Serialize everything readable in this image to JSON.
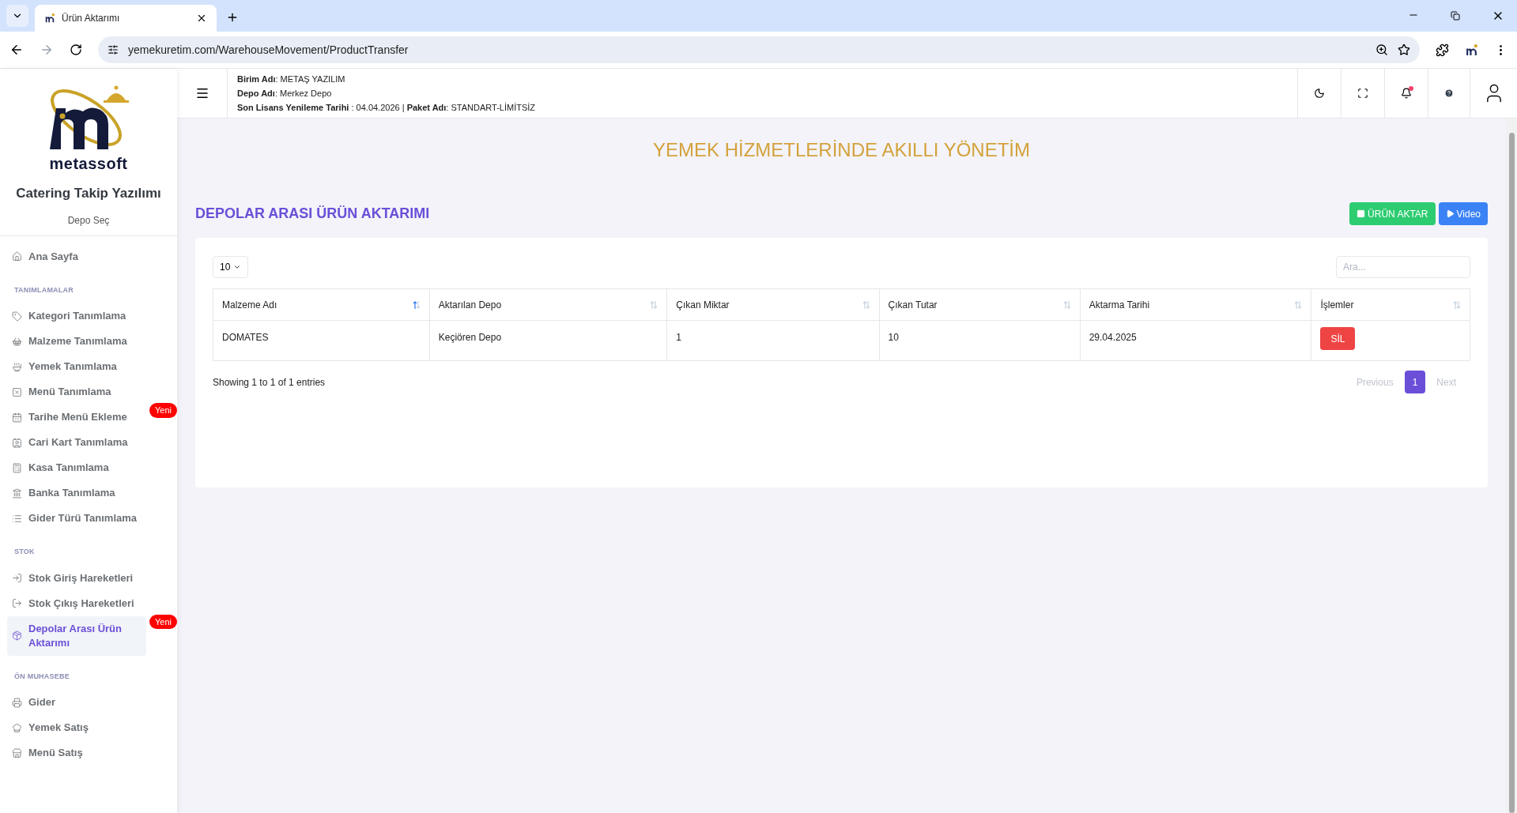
{
  "browser": {
    "tab_title": "Ürün Aktarımı",
    "url": "yemekuretim.com/WarehouseMovement/ProductTransfer"
  },
  "sidebar": {
    "logo_text": "metassoft",
    "app_name": "Catering Takip Yazılımı",
    "depot_link": "Depo Seç",
    "sections": [
      {
        "items": [
          {
            "label": "Ana Sayfa",
            "selected": false
          }
        ]
      },
      {
        "heading": "TANIMLAMALAR",
        "items": [
          {
            "label": "Kategori Tanımlama",
            "selected": false
          },
          {
            "label": "Malzeme Tanımlama",
            "selected": false
          },
          {
            "label": "Yemek Tanımlama",
            "selected": false
          },
          {
            "label": "Menü Tanımlama",
            "selected": false
          },
          {
            "label": "Tarihe Menü Ekleme",
            "selected": false,
            "badge": "Yeni"
          },
          {
            "label": "Cari Kart Tanımlama",
            "selected": false
          },
          {
            "label": "Kasa Tanımlama",
            "selected": false
          },
          {
            "label": "Banka Tanımlama",
            "selected": false
          },
          {
            "label": "Gider Türü Tanımlama",
            "selected": false
          }
        ]
      },
      {
        "heading": "STOK",
        "items": [
          {
            "label": "Stok Giriş Hareketleri",
            "selected": false
          },
          {
            "label": "Stok Çıkış Hareketleri",
            "selected": false
          },
          {
            "label": "Depolar Arası Ürün Aktarımı",
            "selected": true,
            "badge": "Yeni"
          }
        ]
      },
      {
        "heading": "ÖN MUHASEBE",
        "items": [
          {
            "label": "Gider",
            "selected": false
          },
          {
            "label": "Yemek Satış",
            "selected": false
          },
          {
            "label": "Menü Satış",
            "selected": false
          }
        ]
      }
    ]
  },
  "header": {
    "info_lines": [
      "**Birim Adı**: METAŞ YAZILIM",
      "**Depo Adı**: Merkez Depo",
      "**Son Lisans Yenileme Tarihi** : 04.04.2026 | **Paket Adı**: STANDART-LİMİTSİZ"
    ],
    "notification_unread": true
  },
  "banner": "YEMEK HİZMETLERİNDE AKILLI YÖNETİM",
  "page_title": "DEPOLAR ARASI ÜRÜN AKTARIMI",
  "actions": [
    {
      "kind": "add",
      "label": "ÜRÜN AKTAR"
    },
    {
      "kind": "video",
      "label": "Video"
    }
  ],
  "table": {
    "page_size": "10",
    "search": {
      "placeholder": "Ara..."
    },
    "columns": [
      {
        "label": "Malzeme Adı",
        "sorted_ascending": true
      },
      {
        "label": "Aktarılan Depo",
        "sorted_ascending": false
      },
      {
        "label": "Çıkan Miktar",
        "sorted_ascending": false
      },
      {
        "label": "Çıkan Tutar",
        "sorted_ascending": false
      },
      {
        "label": "Aktarma Tarihi",
        "sorted_ascending": false
      },
      {
        "label": "İşlemler",
        "sorted_ascending": false
      }
    ],
    "rows": [
      {
        "cells": [
          "DOMATES",
          "Keçiören Depo",
          "1",
          "10",
          "29.04.2025"
        ],
        "delete_label": "SİL"
      }
    ],
    "info": "Showing 1 to 1 of 1 entries",
    "pagination": [
      {
        "label": "Previous",
        "selected": false,
        "disabled": true
      },
      {
        "label": "1",
        "selected": true,
        "disabled": false
      },
      {
        "label": "Next",
        "selected": false,
        "disabled": true
      }
    ]
  }
}
